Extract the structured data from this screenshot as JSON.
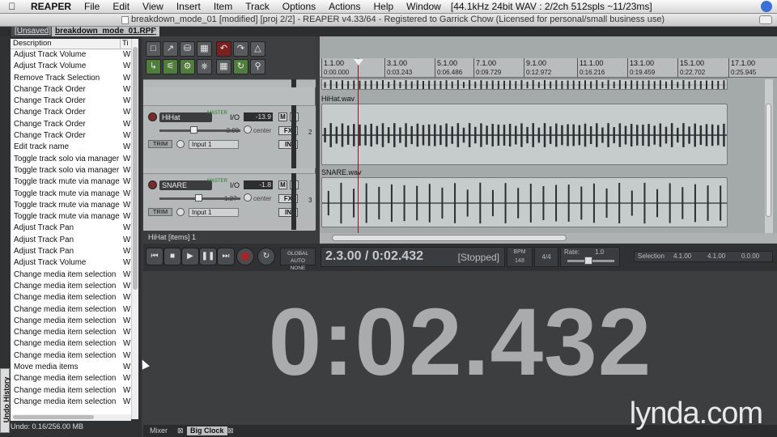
{
  "menubar": {
    "app": "REAPER",
    "items": [
      "File",
      "Edit",
      "View",
      "Insert",
      "Item",
      "Track",
      "Options",
      "Actions",
      "Help",
      "Window"
    ],
    "status": "[44.1kHz 24bit WAV : 2/2ch 512spls ~11/23ms]"
  },
  "title": "breakdown_mode_01 [modified] [proj 2/2] - REAPER v4.33/64 - Registered to Garrick Chow (Licensed for personal/small business use)",
  "project_tabs": [
    {
      "label": "[Unsaved]"
    },
    {
      "label": "breakdown_mode_01.RPP"
    }
  ],
  "undo": {
    "side_label": "Undo History",
    "col_desc": "Description",
    "col_time": "Ti",
    "rows": [
      "Adjust Track Volume",
      "Adjust Track Volume",
      "Remove Track Selection",
      "Change Track Order",
      "Change Track Order",
      "Change Track Order",
      "Change Track Order",
      "Change Track Order",
      "Edit track name",
      "Toggle track solo via manager",
      "Toggle track solo via manager",
      "Toggle track mute via manage",
      "Toggle track mute via manage",
      "Toggle track mute via manage",
      "Toggle track mute via manage",
      "Adjust Track Pan",
      "Adjust Track Pan",
      "Adjust Track Pan",
      "Adjust Track Volume",
      "Change media item selection",
      "Change media item selection",
      "Change media item selection",
      "Change media item selection",
      "Change media item selection",
      "Change media item selection",
      "Change media item selection",
      "Change media item selection",
      "Move media items",
      "Change media item selection",
      "Change media item selection",
      "Change media item selection"
    ],
    "row_time": "W",
    "status": "Undo: 0.16/256.00 MB"
  },
  "tracks": [
    {
      "name": "HiHat",
      "io": "I/O",
      "vol": "-13.9",
      "db": "-2.99",
      "pan": "center",
      "fx": "FX",
      "trim": "TRIM",
      "input": "Input 1",
      "num": "2",
      "master": "MASTER",
      "in_label": "IN"
    },
    {
      "name": "SNARE",
      "io": "I/O",
      "vol": "-1.8",
      "db": "1.27",
      "pan": "center",
      "fx": "FX",
      "trim": "TRIM",
      "input": "Input 1",
      "num": "3",
      "master": "MASTER",
      "in_label": "IN"
    }
  ],
  "tcp_status": "HiHat [items] 1",
  "ruler": [
    {
      "bar": "1.1.00",
      "time": "0:00.000"
    },
    {
      "bar": "3.1.00",
      "time": "0:03.243"
    },
    {
      "bar": "5.1.00",
      "time": "0:06.486"
    },
    {
      "bar": "7.1.00",
      "time": "0:09.729"
    },
    {
      "bar": "9.1.00",
      "time": "0:12.972"
    },
    {
      "bar": "11.1.00",
      "time": "0:16.216"
    },
    {
      "bar": "13.1.00",
      "time": "0:19.459"
    },
    {
      "bar": "15.1.00",
      "time": "0:22.702"
    },
    {
      "bar": "17.1.00",
      "time": "0:25.945"
    }
  ],
  "items": [
    {
      "label": "HiHat.wav"
    },
    {
      "label": "SNARE.wav"
    }
  ],
  "transport": {
    "position": "2.3.00 / 0:02.432",
    "state": "[Stopped]",
    "bpm_label": "BPM",
    "bpm": "148",
    "timesig": "4/4",
    "rate_label": "Rate:",
    "rate": "1.0",
    "global_auto": "GLOBAL AUTO",
    "global_auto_state": "NONE",
    "selection_label": "Selection",
    "sel_start": "4.1.00",
    "sel_end": "4.1.00",
    "sel_len": "0.0.00"
  },
  "bigclock": {
    "time": "0:02.432"
  },
  "docker_tabs": [
    {
      "label": "Mixer"
    },
    {
      "label": "Big Clock"
    }
  ],
  "watermark": "lynda.com",
  "colors": {
    "accent_record": "#b02020",
    "item_bg": "#c6cccb",
    "clock_text": "#a9abad"
  }
}
